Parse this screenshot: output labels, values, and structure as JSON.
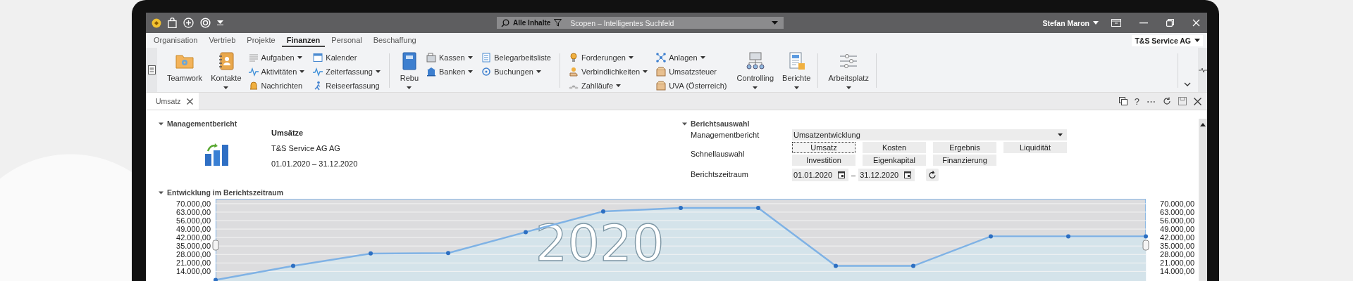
{
  "title_bar": {
    "search": {
      "scope": "Alle Inhalte",
      "placeholder": "Scopen – Intelligentes Suchfeld"
    },
    "user": "Stefan Maron"
  },
  "menu_tabs": [
    {
      "label": "Organisation",
      "selected": false
    },
    {
      "label": "Vertrieb",
      "selected": false
    },
    {
      "label": "Projekte",
      "selected": false
    },
    {
      "label": "Finanzen",
      "selected": true
    },
    {
      "label": "Personal",
      "selected": false
    },
    {
      "label": "Beschaffung",
      "selected": false
    }
  ],
  "company_selector": "T&S Service AG",
  "ribbon": {
    "sections": [
      {
        "items": [
          {
            "kind": "large",
            "label": "Teamwork",
            "dropdown": false
          },
          {
            "kind": "large",
            "label": "Kontakte",
            "dropdown": true
          },
          {
            "kind": "stack",
            "items": [
              {
                "label": "Aufgaben",
                "dropdown": true
              },
              {
                "label": "Aktivitäten",
                "dropdown": true
              },
              {
                "label": "Nachrichten",
                "dropdown": false
              }
            ]
          },
          {
            "kind": "stack",
            "items": [
              {
                "label": "Kalender",
                "dropdown": false
              },
              {
                "label": "Zeiterfassung",
                "dropdown": true
              },
              {
                "label": "Reiseerfassung",
                "dropdown": false
              }
            ]
          }
        ]
      },
      {
        "items": [
          {
            "kind": "large",
            "label": "Rebu",
            "dropdown": true
          },
          {
            "kind": "stack",
            "items": [
              {
                "label": "Kassen",
                "dropdown": true
              },
              {
                "label": "Banken",
                "dropdown": true
              }
            ]
          },
          {
            "kind": "stack",
            "items": [
              {
                "label": "Belegarbeitsliste",
                "dropdown": false
              },
              {
                "label": "Buchungen",
                "dropdown": true
              }
            ]
          }
        ]
      },
      {
        "items": [
          {
            "kind": "stack",
            "items": [
              {
                "label": "Forderungen",
                "dropdown": true
              },
              {
                "label": "Verbindlichkeiten",
                "dropdown": true
              },
              {
                "label": "Zahlläufe",
                "dropdown": true
              }
            ]
          },
          {
            "kind": "stack",
            "items": [
              {
                "label": "Anlagen",
                "dropdown": true
              },
              {
                "label": "Umsatzsteuer",
                "dropdown": false
              },
              {
                "label": "UVA (Österreich)",
                "dropdown": false
              }
            ]
          },
          {
            "kind": "large",
            "label": "Controlling",
            "dropdown": true
          },
          {
            "kind": "large",
            "label": "Berichte",
            "dropdown": true
          }
        ]
      },
      {
        "items": [
          {
            "kind": "large",
            "label": "Arbeitsplatz",
            "dropdown": true
          }
        ]
      }
    ]
  },
  "document_tabs": [
    {
      "label": "Umsatz",
      "selected": true
    }
  ],
  "document_tools": [
    "?",
    "⋯"
  ],
  "report_info": {
    "header": "Managementbericht",
    "expanded": true,
    "title": "Umsätze",
    "company": "T&S Service AG AG",
    "period": "01.01.2020 – 31.12.2020"
  },
  "report_selection": {
    "header": "Berichtsauswahl",
    "expanded": true,
    "report_label": "Managementbericht",
    "report_value": "Umsatzentwicklung",
    "quick_label": "Schnellauswahl",
    "quick_buttons": [
      {
        "label": "Umsatz",
        "selected": true
      },
      {
        "label": "Kosten",
        "selected": false
      },
      {
        "label": "Ergebnis",
        "selected": false
      },
      {
        "label": "Liquidität",
        "selected": false
      },
      {
        "label": "Investition",
        "selected": false
      },
      {
        "label": "Eigenkapital",
        "selected": false
      },
      {
        "label": "Finanzierung",
        "selected": false
      }
    ],
    "period_label": "Berichtszeitraum",
    "period_from": "01.01.2020",
    "period_separator": "–",
    "period_to": "31.12.2020"
  },
  "chart_section": {
    "header": "Entwicklung im Berichtszeitraum",
    "expanded": true,
    "watermark": "2020",
    "right_axis_labels": [
      "70.000,00",
      "63.000,00",
      "56.000,00",
      "49.000,00",
      "42.000,00",
      "35.000,00",
      "28.000,00",
      "21.000,00",
      "14.000,00"
    ],
    "chart_data": {
      "type": "area",
      "grid": true,
      "ylim": [
        0,
        74000
      ],
      "yticks": [
        {
          "value": 70000,
          "label": "70.000,00"
        },
        {
          "value": 63000,
          "label": "63.000,00"
        },
        {
          "value": 56000,
          "label": "56.000,00"
        },
        {
          "value": 49000,
          "label": "49.000,00"
        },
        {
          "value": 42000,
          "label": "42.000,00"
        },
        {
          "value": 35000,
          "label": "35.000,00"
        },
        {
          "value": 28000,
          "label": "28.000,00"
        },
        {
          "value": 21000,
          "label": "21.000,00"
        },
        {
          "value": 14000,
          "label": "14.000,00"
        }
      ],
      "series": [
        {
          "color": "#7fb2e5",
          "values": [
            7000,
            18500,
            28800,
            29200,
            46500,
            63600,
            66500,
            66500,
            18500,
            18500,
            43000,
            43000,
            43000
          ]
        }
      ]
    }
  }
}
